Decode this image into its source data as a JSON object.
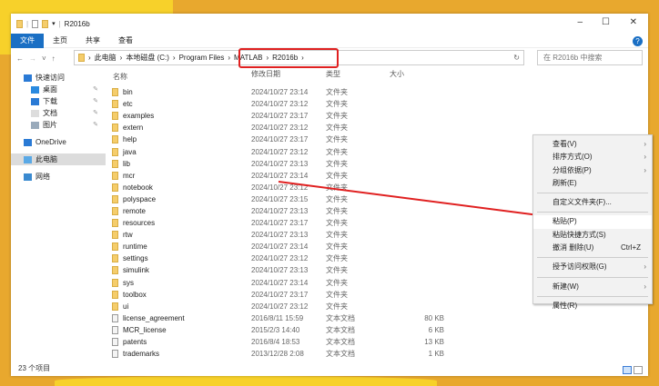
{
  "window": {
    "title": "R2016b",
    "minimize": "–",
    "maximize": "☐",
    "close": "✕",
    "help": "?"
  },
  "ribbon": {
    "tabs": [
      "文件",
      "主页",
      "共享",
      "查看"
    ]
  },
  "address": {
    "back": "←",
    "forward": "→",
    "recent": "˅",
    "up": "↑",
    "crumbs": [
      "此电脑",
      "本地磁盘 (C:)",
      "Program Files",
      "MATLAB",
      "R2016b"
    ],
    "sep": "›",
    "refresh": "↻",
    "search_placeholder": "在 R2016b 中搜索"
  },
  "sidebar": {
    "items": [
      {
        "label": "快速访问",
        "icon": "star-icon"
      },
      {
        "label": "桌面",
        "icon": "desktop-icon",
        "pinned": true
      },
      {
        "label": "下载",
        "icon": "download-icon",
        "pinned": true
      },
      {
        "label": "文档",
        "icon": "document-icon",
        "pinned": true
      },
      {
        "label": "图片",
        "icon": "pictures-icon",
        "pinned": true
      },
      {
        "label": "OneDrive",
        "icon": "cloud-icon"
      },
      {
        "label": "此电脑",
        "icon": "computer-icon",
        "selected": true
      },
      {
        "label": "网络",
        "icon": "network-icon"
      }
    ],
    "pin": "📌"
  },
  "columns": [
    "名称",
    "修改日期",
    "类型",
    "大小"
  ],
  "files": [
    {
      "name": "bin",
      "date": "2024/10/27 23:14",
      "type": "文件夹",
      "size": ""
    },
    {
      "name": "etc",
      "date": "2024/10/27 23:12",
      "type": "文件夹",
      "size": ""
    },
    {
      "name": "examples",
      "date": "2024/10/27 23:17",
      "type": "文件夹",
      "size": ""
    },
    {
      "name": "extern",
      "date": "2024/10/27 23:12",
      "type": "文件夹",
      "size": ""
    },
    {
      "name": "help",
      "date": "2024/10/27 23:17",
      "type": "文件夹",
      "size": ""
    },
    {
      "name": "java",
      "date": "2024/10/27 23:12",
      "type": "文件夹",
      "size": ""
    },
    {
      "name": "lib",
      "date": "2024/10/27 23:13",
      "type": "文件夹",
      "size": ""
    },
    {
      "name": "mcr",
      "date": "2024/10/27 23:14",
      "type": "文件夹",
      "size": ""
    },
    {
      "name": "notebook",
      "date": "2024/10/27 23:12",
      "type": "文件夹",
      "size": ""
    },
    {
      "name": "polyspace",
      "date": "2024/10/27 23:15",
      "type": "文件夹",
      "size": ""
    },
    {
      "name": "remote",
      "date": "2024/10/27 23:13",
      "type": "文件夹",
      "size": ""
    },
    {
      "name": "resources",
      "date": "2024/10/27 23:17",
      "type": "文件夹",
      "size": ""
    },
    {
      "name": "rtw",
      "date": "2024/10/27 23:13",
      "type": "文件夹",
      "size": ""
    },
    {
      "name": "runtime",
      "date": "2024/10/27 23:14",
      "type": "文件夹",
      "size": ""
    },
    {
      "name": "settings",
      "date": "2024/10/27 23:12",
      "type": "文件夹",
      "size": ""
    },
    {
      "name": "simulink",
      "date": "2024/10/27 23:13",
      "type": "文件夹",
      "size": ""
    },
    {
      "name": "sys",
      "date": "2024/10/27 23:14",
      "type": "文件夹",
      "size": ""
    },
    {
      "name": "toolbox",
      "date": "2024/10/27 23:17",
      "type": "文件夹",
      "size": ""
    },
    {
      "name": "ui",
      "date": "2024/10/27 23:12",
      "type": "文件夹",
      "size": ""
    },
    {
      "name": "license_agreement",
      "date": "2016/8/11 15:59",
      "type": "文本文档",
      "size": "80 KB"
    },
    {
      "name": "MCR_license",
      "date": "2015/2/3 14:40",
      "type": "文本文档",
      "size": "6 KB"
    },
    {
      "name": "patents",
      "date": "2016/8/4 18:53",
      "type": "文本文档",
      "size": "13 KB"
    },
    {
      "name": "trademarks",
      "date": "2013/12/28 2:08",
      "type": "文本文档",
      "size": "1 KB"
    }
  ],
  "status": "23 个项目",
  "context_menu": [
    {
      "label": "查看(V)",
      "arrow": "›"
    },
    {
      "label": "排序方式(O)",
      "arrow": "›"
    },
    {
      "label": "分组依据(P)",
      "arrow": "›"
    },
    {
      "label": "刷新(E)"
    },
    {
      "sep": true
    },
    {
      "label": "自定义文件夹(F)..."
    },
    {
      "sep": true
    },
    {
      "label": "粘贴(P)",
      "highlight": true
    },
    {
      "label": "粘贴快捷方式(S)"
    },
    {
      "label": "撤消 删除(U)",
      "shortcut": "Ctrl+Z"
    },
    {
      "sep": true
    },
    {
      "label": "授予访问权限(G)",
      "arrow": "›"
    },
    {
      "sep": true
    },
    {
      "label": "新建(W)",
      "arrow": "›"
    },
    {
      "sep": true
    },
    {
      "label": "属性(R)"
    }
  ],
  "colors": {
    "accent": "#1a6fc4",
    "annotation": "#e02020",
    "background": "#e8a82e"
  }
}
